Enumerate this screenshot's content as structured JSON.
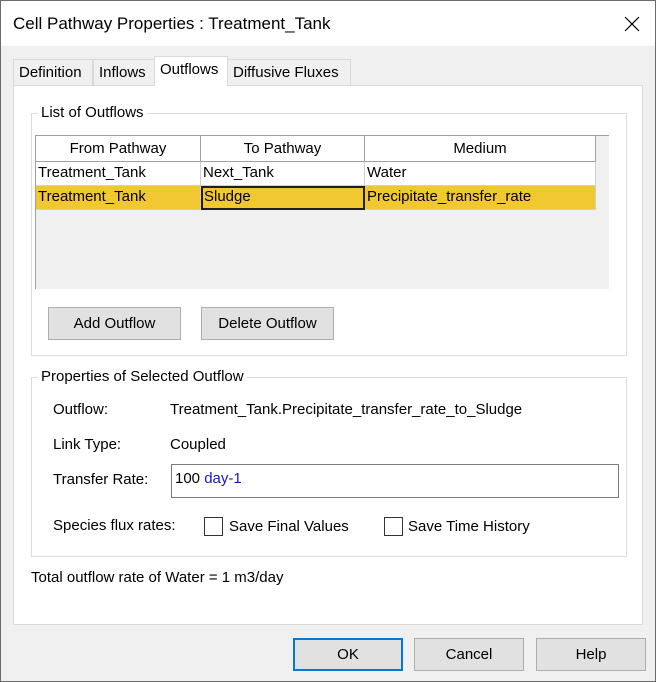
{
  "window": {
    "title": "Cell Pathway Properties : Treatment_Tank"
  },
  "tabs": [
    {
      "label": "Definition"
    },
    {
      "label": "Inflows"
    },
    {
      "label": "Outflows",
      "active": true
    },
    {
      "label": "Diffusive Fluxes"
    }
  ],
  "outflows_group": {
    "title": "List of Outflows",
    "columns": [
      "From Pathway",
      "To Pathway",
      "Medium"
    ],
    "rows": [
      {
        "from": "Treatment_Tank",
        "to": "Next_Tank",
        "medium": "Water",
        "selected": false
      },
      {
        "from": "Treatment_Tank",
        "to": "Sludge",
        "medium": "Precipitate_transfer_rate",
        "selected": true
      }
    ],
    "add_button": "Add Outflow",
    "delete_button": "Delete Outflow"
  },
  "properties_group": {
    "title": "Properties of Selected Outflow",
    "outflow_label": "Outflow:",
    "outflow_value": "Treatment_Tank.Precipitate_transfer_rate_to_Sludge",
    "link_type_label": "Link Type:",
    "link_type_value": "Coupled",
    "transfer_rate_label": "Transfer Rate:",
    "transfer_rate_number": "100",
    "transfer_rate_unit": "day-1",
    "species_label": "Species flux rates:",
    "save_final_label": "Save Final Values",
    "save_final_checked": false,
    "save_history_label": "Save Time History",
    "save_history_checked": false
  },
  "total_text": "Total outflow rate of Water = 1 m3/day",
  "dialog_buttons": {
    "ok": "OK",
    "cancel": "Cancel",
    "help": "Help"
  },
  "colors": {
    "selected_row": "#f2c830",
    "default_button_border": "#0078d7",
    "unit_text": "#1a1ab0"
  },
  "icons": {
    "close": "close-icon"
  }
}
